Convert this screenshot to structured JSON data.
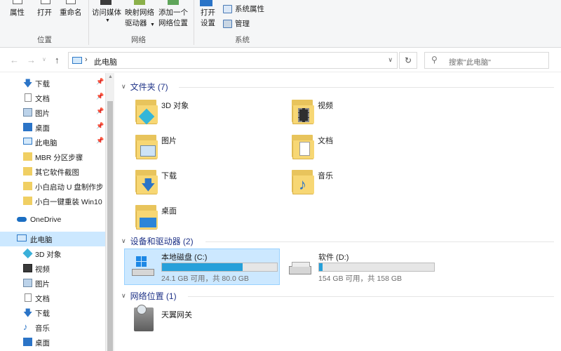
{
  "ribbon": {
    "buttons": [
      {
        "label": "属性"
      },
      {
        "label": "打开"
      },
      {
        "label": "重命名"
      },
      {
        "label": "访问媒体"
      },
      {
        "label1": "映射网络",
        "label2": "驱动器"
      },
      {
        "label1": "添加一个",
        "label2": "网络位置"
      },
      {
        "label1": "打开",
        "label2": "设置"
      }
    ],
    "small_buttons": [
      {
        "label": "系统属性"
      },
      {
        "label": "管理"
      }
    ],
    "groups": [
      "位置",
      "网络",
      "系统"
    ]
  },
  "address": {
    "crumb": "此电脑",
    "search_placeholder": "搜索\"此电脑\""
  },
  "sidebar": {
    "items": [
      {
        "label": "下载",
        "icon": "download-icon",
        "pinned": true
      },
      {
        "label": "文档",
        "icon": "document-icon",
        "pinned": true
      },
      {
        "label": "图片",
        "icon": "pictures-icon",
        "pinned": true
      },
      {
        "label": "桌面",
        "icon": "desktop-icon",
        "pinned": true
      },
      {
        "label": "此电脑",
        "icon": "computer-icon",
        "pinned": true
      },
      {
        "label": "MBR 分区步骤",
        "icon": "folder-icon",
        "pinned": false
      },
      {
        "label": "其它软件截图",
        "icon": "folder-icon",
        "pinned": false
      },
      {
        "label": "小白启动 U 盘制作步",
        "icon": "folder-icon",
        "pinned": false
      },
      {
        "label": "小白一键重装 Win10",
        "icon": "folder-icon",
        "pinned": false
      },
      {
        "label": "OneDrive",
        "icon": "cloud-icon",
        "pinned": false
      },
      {
        "label": "此电脑",
        "icon": "computer-icon",
        "pinned": false,
        "selected": true
      },
      {
        "label": "3D 对象",
        "icon": "3d-objects-icon",
        "pinned": false
      },
      {
        "label": "视频",
        "icon": "video-icon",
        "pinned": false
      },
      {
        "label": "图片",
        "icon": "pictures-icon",
        "pinned": false
      },
      {
        "label": "文档",
        "icon": "document-icon",
        "pinned": false
      },
      {
        "label": "下载",
        "icon": "download-icon",
        "pinned": false
      },
      {
        "label": "音乐",
        "icon": "music-icon",
        "pinned": false
      },
      {
        "label": "桌面",
        "icon": "desktop-icon",
        "pinned": false
      }
    ]
  },
  "folders_section": {
    "title": "文件夹 (7)",
    "items": [
      {
        "label": "3D 对象",
        "icon": "3d-objects-folder-icon"
      },
      {
        "label": "视频",
        "icon": "videos-folder-icon"
      },
      {
        "label": "图片",
        "icon": "pictures-folder-icon"
      },
      {
        "label": "文档",
        "icon": "documents-folder-icon"
      },
      {
        "label": "下载",
        "icon": "downloads-folder-icon"
      },
      {
        "label": "音乐",
        "icon": "music-folder-icon"
      },
      {
        "label": "桌面",
        "icon": "desktop-folder-icon"
      }
    ]
  },
  "drives_section": {
    "title": "设备和驱动器 (2)",
    "drives": [
      {
        "name": "本地磁盘 (C:)",
        "info": "24.1 GB 可用，共 80.0 GB",
        "used_fraction": 0.7,
        "selected": true
      },
      {
        "name": "软件 (D:)",
        "info": "154 GB 可用，共 158 GB",
        "used_fraction": 0.03,
        "selected": false
      }
    ]
  },
  "network_section": {
    "title": "网络位置 (1)",
    "items": [
      {
        "label": "天翼网关",
        "icon": "network-gateway-icon"
      }
    ]
  },
  "colors": {
    "accent": "#26a0da",
    "selection": "#cce8ff",
    "header": "#1e3287"
  }
}
